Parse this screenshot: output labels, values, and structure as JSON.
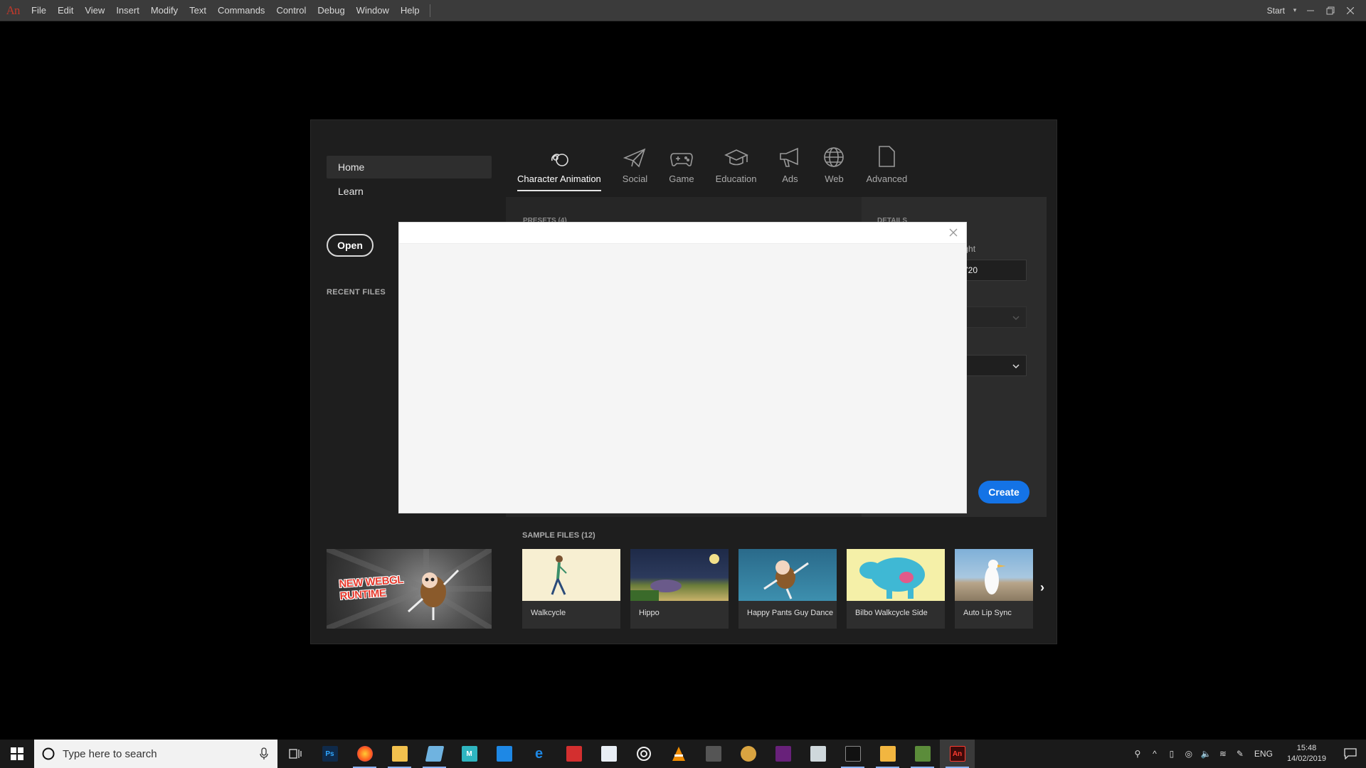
{
  "menubar": {
    "logo": "An",
    "items": [
      "File",
      "Edit",
      "View",
      "Insert",
      "Modify",
      "Text",
      "Commands",
      "Control",
      "Debug",
      "Window",
      "Help"
    ],
    "workspace": "Start"
  },
  "nav": {
    "home": "Home",
    "learn": "Learn",
    "open": "Open",
    "recent_files": "RECENT FILES"
  },
  "promo": {
    "text_line1": "NEW WEBGL",
    "text_line2": "RUNTIME"
  },
  "tabs": [
    {
      "label": "Character Animation",
      "icon": "character-animation-icon",
      "active": true
    },
    {
      "label": "Social",
      "icon": "paper-plane-icon"
    },
    {
      "label": "Game",
      "icon": "gamepad-icon"
    },
    {
      "label": "Education",
      "icon": "graduation-cap-icon"
    },
    {
      "label": "Ads",
      "icon": "megaphone-icon"
    },
    {
      "label": "Web",
      "icon": "globe-icon"
    },
    {
      "label": "Advanced",
      "icon": "document-icon"
    }
  ],
  "presets": {
    "label": "PRESETS (4)"
  },
  "details": {
    "label": "DETAILS",
    "height_label": "eight",
    "height_value": "720"
  },
  "create_button": "Create",
  "samples": {
    "title": "SAMPLE FILES (12)",
    "items": [
      "Walkcycle",
      "Hippo",
      "Happy Pants Guy Dance",
      "Bilbo Walkcycle Side",
      "Auto Lip Sync"
    ]
  },
  "taskbar": {
    "search_placeholder": "Type here to search",
    "lang": "ENG",
    "time": "15:48",
    "date": "14/02/2019"
  },
  "colors": {
    "accent": "#1473e6",
    "brand": "#c0392b"
  }
}
